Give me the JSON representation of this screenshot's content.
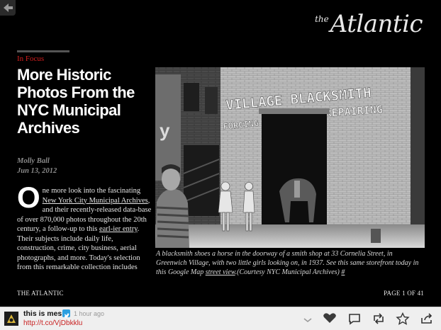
{
  "header": {
    "logo_prefix": "the",
    "logo_name": "Atlantic"
  },
  "article": {
    "section": "In Focus",
    "headline": "More Historic Photos From the NYC Municipal Archives",
    "author": "Molly Ball",
    "date": "Jun 13, 2012",
    "dropcap": "O",
    "body_1": "ne more look into the fascinating ",
    "body_link_1": "New York City Municipal Archives",
    "body_2": ", and their recently-released data-base of over 870,000 photos throughout the 20th century, a follow-up to this ",
    "body_link_2": "earl-ier entry",
    "body_3": ". Their subjects include daily life, construction, crime, city business, aerial photographs, and more. Today's selection from this remarkable collection includes"
  },
  "photo": {
    "sign_text": "VILLAGE BLACKSMITH",
    "sign_left": "FORGING",
    "sign_right": "REPAIRING",
    "caption_1": "A blacksmith shoes a horse in the doorway of a smith shop at 33 Cornelia Street, in Greenwich Village, with two little girls looking on, in 1937. See this same storefront today in this Google Map ",
    "caption_link": "street view",
    "caption_2": ".(Courtesy NYC Municipal Archives) ",
    "caption_hash": "#"
  },
  "footer": {
    "publication": "THE ATLANTIC",
    "page_indicator": "PAGE 1 OF 41"
  },
  "social_bar": {
    "username": "this is mess",
    "timestamp": "1 hour ago",
    "link": "http://t.co/VjDbkklu",
    "icons": [
      "chevron-down-icon",
      "heart-icon",
      "comment-icon",
      "retweet-icon",
      "star-icon",
      "share-icon"
    ]
  },
  "colors": {
    "background": "#000000",
    "section_red": "#d21e1e",
    "link_red": "#c81f1f",
    "bar_bg": "#efefef"
  }
}
